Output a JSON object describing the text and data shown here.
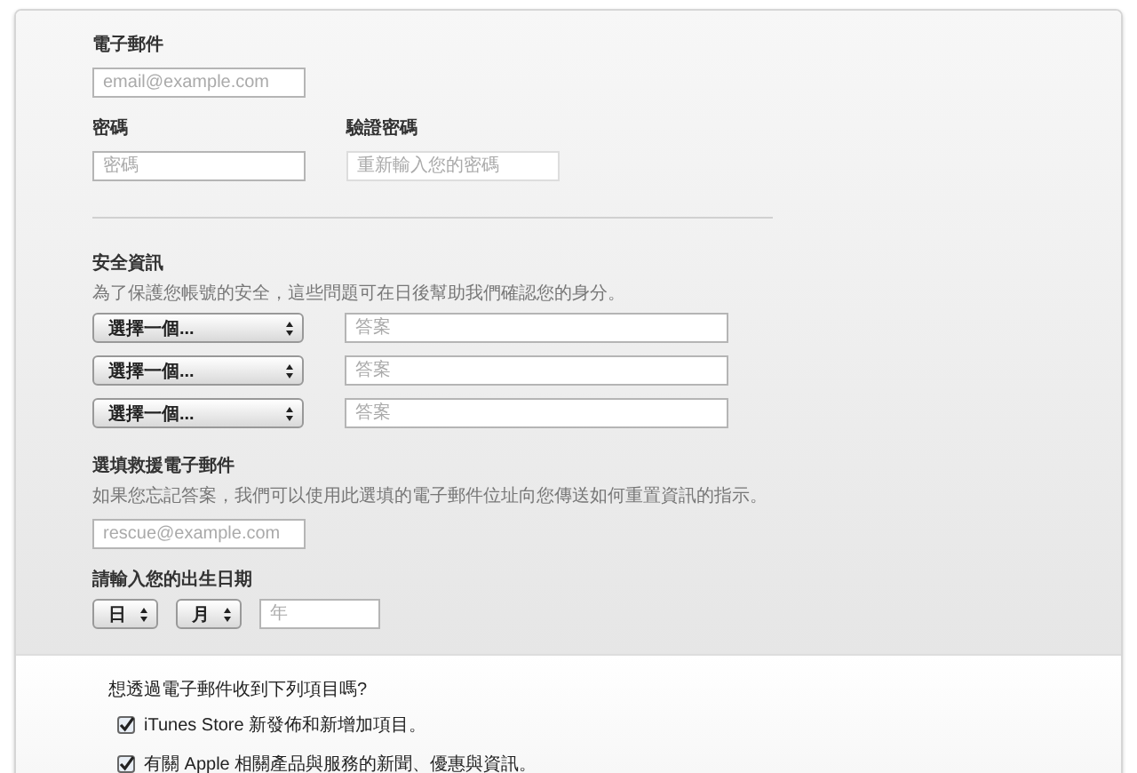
{
  "email": {
    "label": "電子郵件",
    "placeholder": "email@example.com"
  },
  "password": {
    "label": "密碼",
    "placeholder": "密碼"
  },
  "confirm_password": {
    "label": "驗證密碼",
    "placeholder": "重新輸入您的密碼"
  },
  "security": {
    "title": "安全資訊",
    "description": "為了保護您帳號的安全，這些問題可在日後幫助我們確認您的身分。",
    "questions": [
      {
        "select": "選擇一個...",
        "placeholder": "答案"
      },
      {
        "select": "選擇一個...",
        "placeholder": "答案"
      },
      {
        "select": "選擇一個...",
        "placeholder": "答案"
      }
    ]
  },
  "rescue_email": {
    "title": "選填救援電子郵件",
    "description": "如果您忘記答案，我們可以使用此選填的電子郵件位址向您傳送如何重置資訊的指示。",
    "placeholder": "rescue@example.com"
  },
  "birthday": {
    "title": "請輸入您的出生日期",
    "day": "日",
    "month": "月",
    "year_placeholder": "年"
  },
  "newsletter": {
    "question": "想透過電子郵件收到下列項目嗎?",
    "options": [
      {
        "label": "iTunes Store 新發佈和新增加項目。",
        "checked": true
      },
      {
        "label": "有關 Apple 相關產品與服務的新聞、優惠與資訊。",
        "checked": true
      }
    ]
  }
}
